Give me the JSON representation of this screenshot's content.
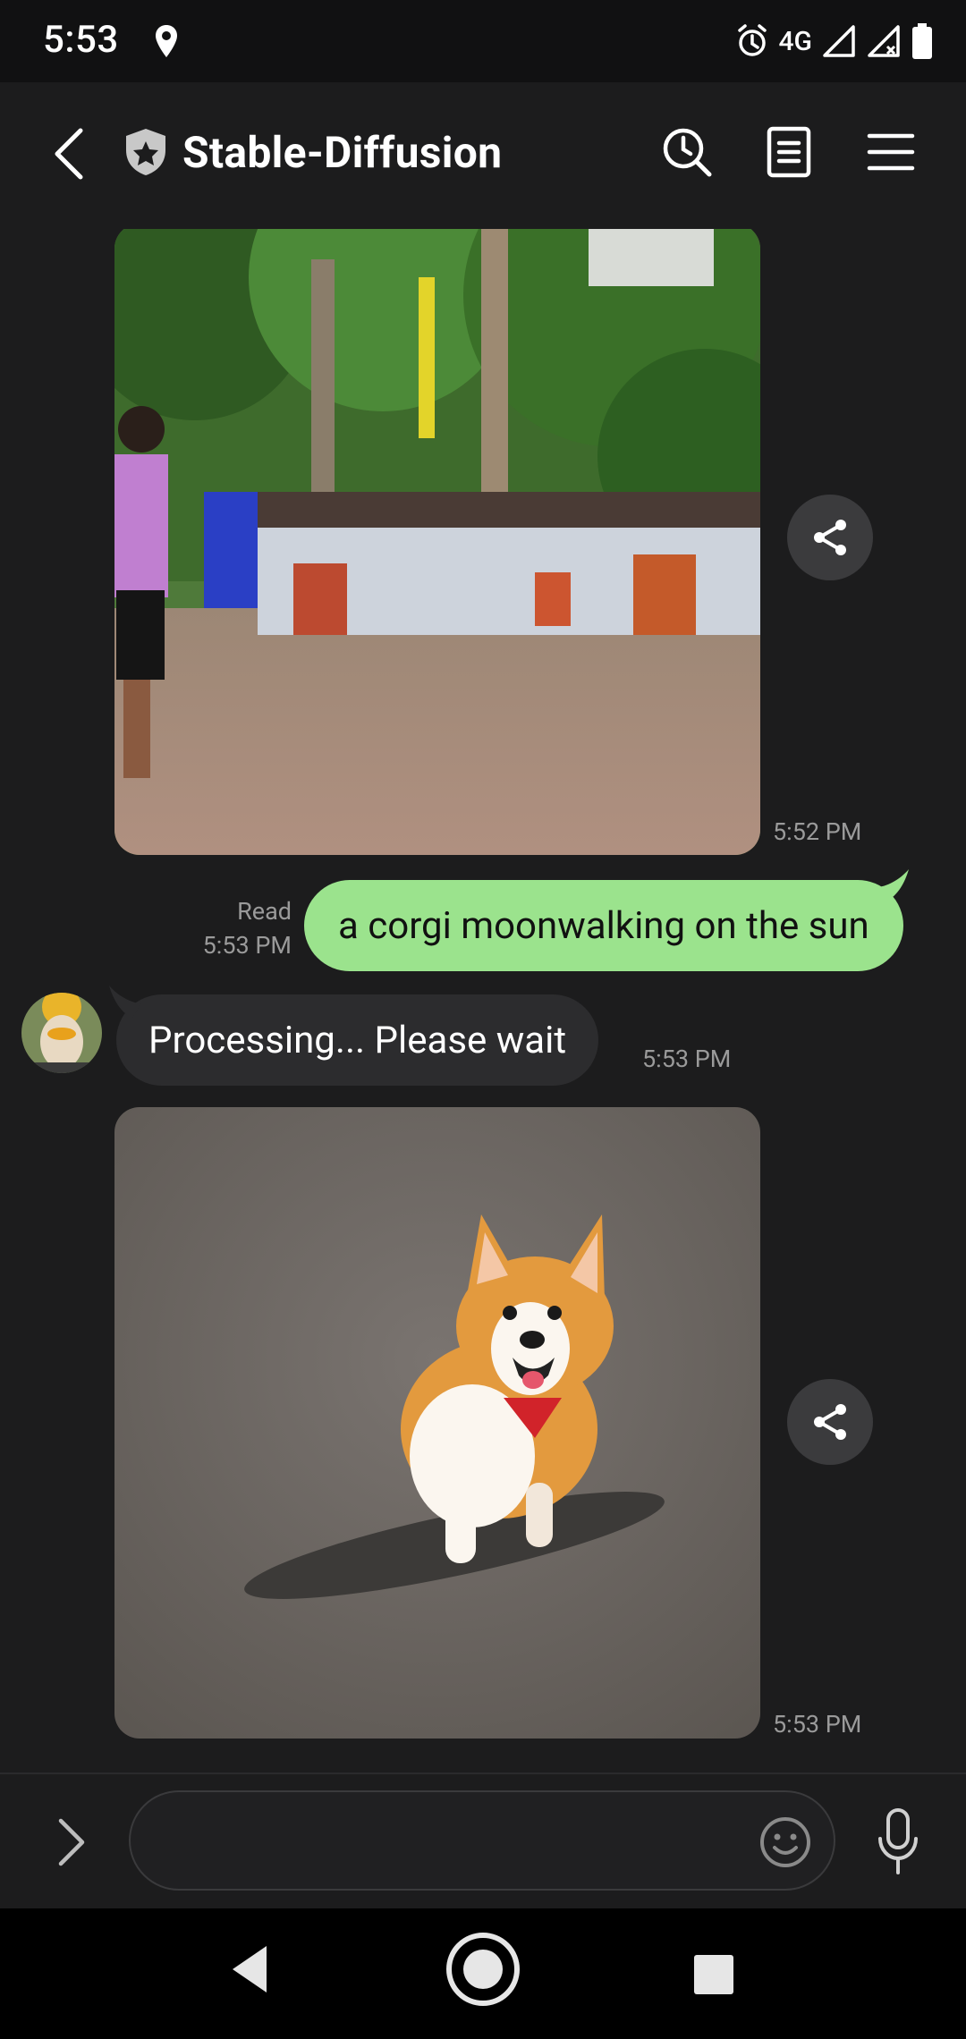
{
  "status_bar": {
    "time": "5:53",
    "network": "4G"
  },
  "header": {
    "title": "Stable-Diffusion"
  },
  "messages": {
    "image1_time": "5:52 PM",
    "user_text": "a corgi moonwalking on the sun",
    "user_read_label": "Read",
    "user_time": "5:53 PM",
    "bot_text": "Processing... Please wait",
    "bot_time": "5:53 PM",
    "image2_time": "5:53 PM"
  },
  "composer": {
    "placeholder": ""
  },
  "colors": {
    "outgoing_bubble": "#9be38d",
    "incoming_bubble": "#2c2c2e",
    "background": "#1c1c1d"
  },
  "icons": [
    "location-pin-icon",
    "alarm-icon",
    "signal-icon",
    "battery-icon",
    "back-arrow-icon",
    "shield-star-icon",
    "history-icon",
    "notes-icon",
    "menu-icon",
    "share-icon",
    "expand-icon",
    "emoji-icon",
    "microphone-icon",
    "nav-back-icon",
    "nav-home-icon",
    "nav-recents-icon"
  ]
}
